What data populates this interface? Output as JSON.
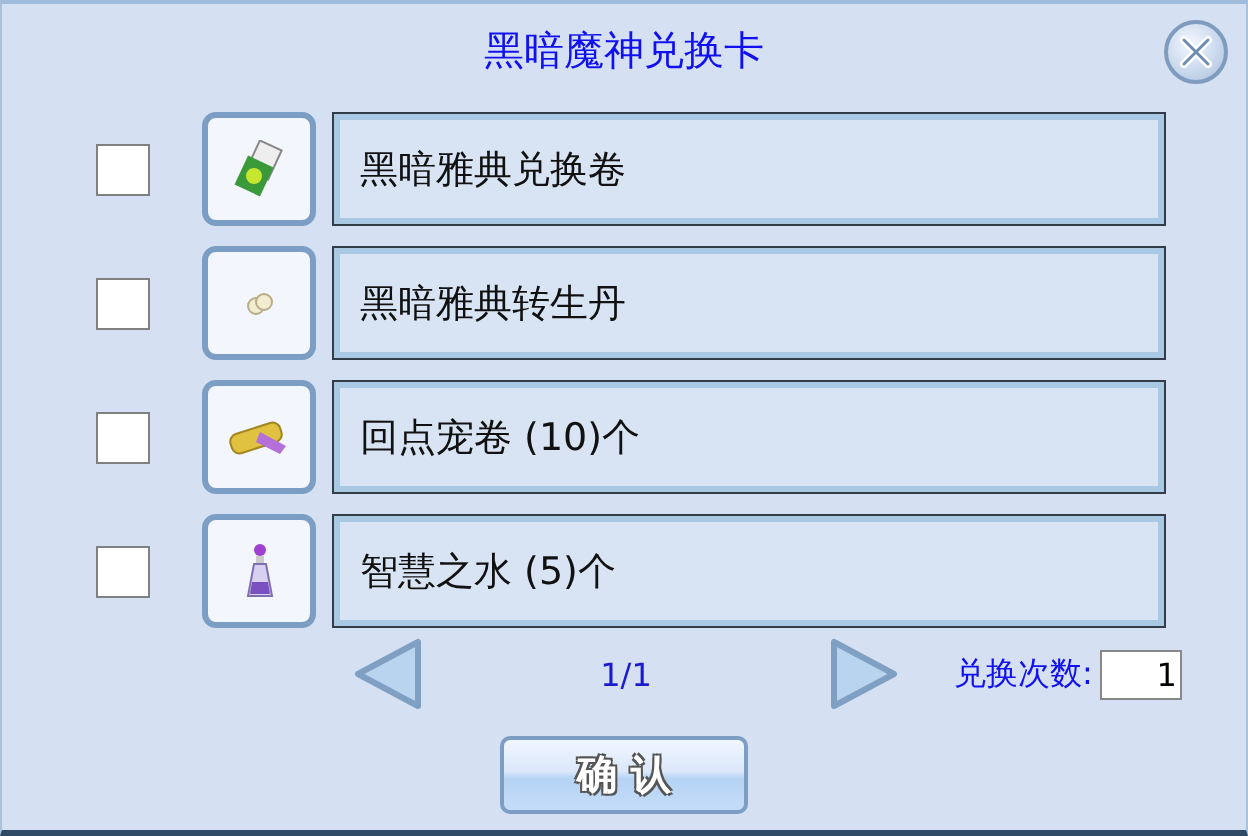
{
  "window": {
    "title": "黑暗魔神兑换卡"
  },
  "items": [
    {
      "name": "黑暗雅典兑换卷",
      "checked": false
    },
    {
      "name": "黑暗雅典转生丹",
      "checked": false
    },
    {
      "name": "回点宠卷 (10)个",
      "checked": false
    },
    {
      "name": "智慧之水 (5)个",
      "checked": false
    }
  ],
  "pager": {
    "page": "1/1"
  },
  "exchange_count": {
    "label": "兑换次数:",
    "value": "1"
  },
  "buttons": [
    "确 认"
  ]
}
